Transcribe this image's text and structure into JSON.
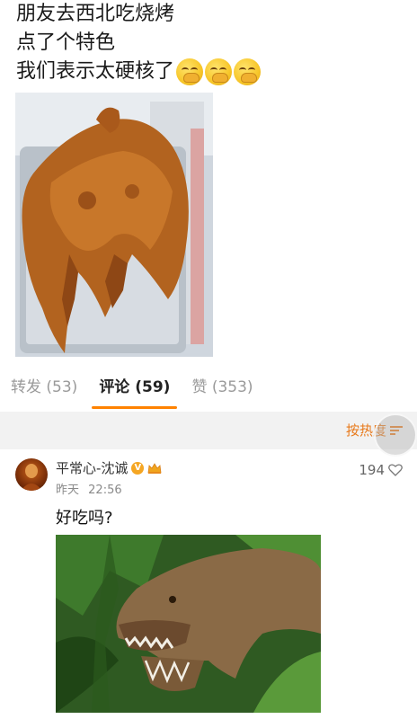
{
  "post": {
    "line1": "朋友去西北吃烧烤",
    "line2": "点了个特色",
    "line3": "我们表示太硬核了",
    "emoji": "smirk-hand-emoji"
  },
  "tabs": [
    {
      "label": "转发",
      "count": "(53)"
    },
    {
      "label": "评论",
      "count": "(59)"
    },
    {
      "label": "赞",
      "count": "(353)"
    }
  ],
  "sort": {
    "label": "按热度"
  },
  "comment": {
    "username": "平常心-沈诚",
    "time_day": "昨天",
    "time_clock": "22:56",
    "likes": "194",
    "text": "好吃吗?"
  },
  "colors": {
    "accent": "#ff8200",
    "sort_text": "#e8791a",
    "muted": "#9a9a9a"
  }
}
